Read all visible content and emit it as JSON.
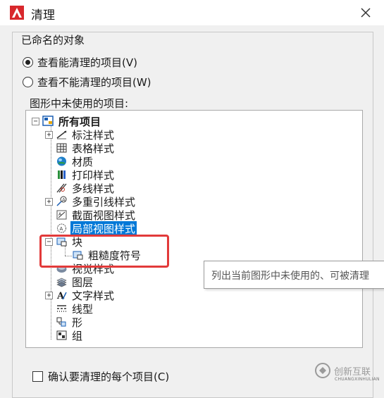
{
  "window": {
    "title": "清理"
  },
  "named_objects": {
    "group_title": "已命名的对象",
    "radio_purgeable": {
      "label": "查看能清理的项目(V)",
      "checked": true
    },
    "radio_not_purgeable": {
      "label": "查看不能清理的项目(W)",
      "checked": false
    },
    "unused_label": "图形中未使用的项目:"
  },
  "tree": {
    "root": "所有项目",
    "items": [
      {
        "label": "标注样式",
        "icon": "dimension-style-icon",
        "expander": "+"
      },
      {
        "label": "表格样式",
        "icon": "table-style-icon",
        "expander": ""
      },
      {
        "label": "材质",
        "icon": "material-icon",
        "expander": ""
      },
      {
        "label": "打印样式",
        "icon": "plot-style-icon",
        "expander": ""
      },
      {
        "label": "多线样式",
        "icon": "multiline-style-icon",
        "expander": ""
      },
      {
        "label": "多重引线样式",
        "icon": "multileader-style-icon",
        "expander": "+"
      },
      {
        "label": "截面视图样式",
        "icon": "section-view-style-icon",
        "expander": ""
      },
      {
        "label": "局部视图样式",
        "icon": "detail-view-style-icon",
        "expander": "",
        "selected": true
      },
      {
        "label": "块",
        "icon": "block-icon",
        "expander": "-"
      },
      {
        "label": "视觉样式",
        "icon": "visual-style-icon",
        "expander": ""
      },
      {
        "label": "图层",
        "icon": "layer-icon",
        "expander": ""
      },
      {
        "label": "文字样式",
        "icon": "text-style-icon",
        "expander": "+"
      },
      {
        "label": "线型",
        "icon": "linetype-icon",
        "expander": ""
      },
      {
        "label": "形",
        "icon": "shape-icon",
        "expander": ""
      },
      {
        "label": "组",
        "icon": "group-icon",
        "expander": ""
      }
    ],
    "block_child": "粗糙度符号"
  },
  "tooltip": "列出当前图形中未使用的、可被清理",
  "confirm": {
    "label": "确认要清理的每个项目(C)",
    "checked": false
  },
  "watermark": {
    "text": "创新互联",
    "sub": "CHUANGXINHULIAN"
  },
  "colors": {
    "selection": "#0078d7",
    "highlight": "#e23a3a",
    "app_red": "#d8282c"
  }
}
